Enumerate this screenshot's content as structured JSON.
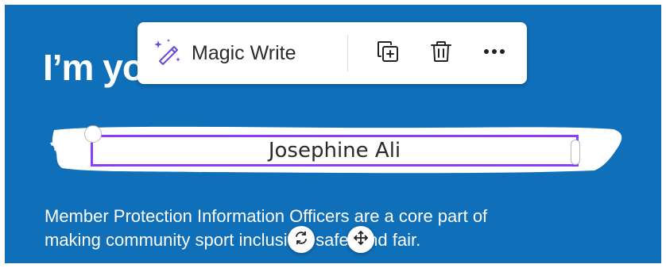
{
  "canvas": {
    "heading_visible": "I’m yo",
    "name_field": {
      "value": "Josephine Ali"
    },
    "description_lines": [
      "Member Protection Information Officers are a core part of",
      "making community sport inclusive, safe, and fair."
    ],
    "background_color": "#0f6fb9",
    "selection_color": "#8b3dff"
  },
  "toolbar": {
    "magic_write_label": "Magic Write",
    "magic_write_icon": "magic-wand-icon",
    "duplicate_icon": "duplicate-icon",
    "delete_icon": "trash-icon",
    "more_icon": "more-horizontal-icon"
  },
  "floating_controls": {
    "rotate_icon": "rotate-icon",
    "move_icon": "move-icon"
  }
}
